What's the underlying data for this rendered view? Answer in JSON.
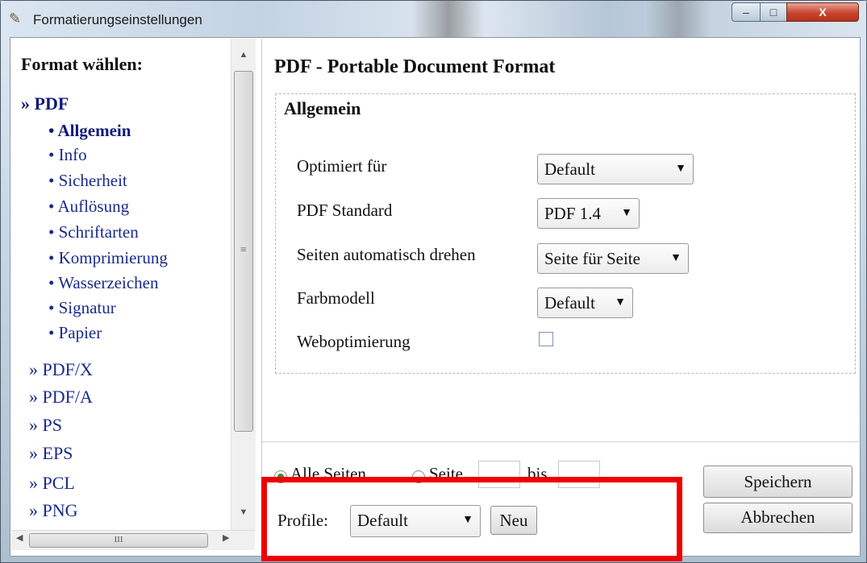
{
  "window": {
    "title": "Formatierungseinstellungen",
    "controls": {
      "minimize": "–",
      "maximize": "□",
      "close": "X"
    }
  },
  "sidebar": {
    "heading": "Format wählen:",
    "formats": [
      {
        "label": "» PDF",
        "active": true
      },
      {
        "label": "» PDF/X"
      },
      {
        "label": "» PDF/A"
      },
      {
        "label": "» PS"
      },
      {
        "label": "» EPS"
      },
      {
        "label": "» PCL"
      },
      {
        "label": "» PNG"
      }
    ],
    "pdf_sections": [
      {
        "label": "• Allgemein",
        "active": true
      },
      {
        "label": "• Info"
      },
      {
        "label": "• Sicherheit"
      },
      {
        "label": "• Auflösung"
      },
      {
        "label": "• Schriftarten"
      },
      {
        "label": "• Komprimierung"
      },
      {
        "label": "• Wasserzeichen"
      },
      {
        "label": "• Signatur"
      },
      {
        "label": "• Papier"
      }
    ],
    "scrollbar": {
      "grip": "≡",
      "hgrip": "III",
      "up": "▲",
      "down": "▼",
      "left": "◀",
      "right": "▶"
    }
  },
  "main": {
    "title": "PDF - Portable Document Format",
    "group_title": "Allgemein",
    "fields": {
      "optimized_label": "Optimiert für",
      "optimized_value": "Default",
      "pdf_standard_label": "PDF Standard",
      "pdf_standard_value": "PDF 1.4",
      "rotate_label": "Seiten automatisch drehen",
      "rotate_value": "Seite für Seite",
      "color_label": "Farbmodell",
      "color_value": "Default",
      "weboptim_label": "Weboptimierung",
      "weboptim_checked": false
    }
  },
  "pages": {
    "all_label": "Alle Seiten",
    "page_label": "Seite",
    "to_label": "bis",
    "all_selected": true
  },
  "profile": {
    "label": "Profile:",
    "value": "Default",
    "new_button": "Neu"
  },
  "buttons": {
    "save": "Speichern",
    "cancel": "Abbrechen"
  },
  "caret": "▼",
  "colors": {
    "highlight": "#ee0000",
    "link": "#1a2a8c"
  }
}
